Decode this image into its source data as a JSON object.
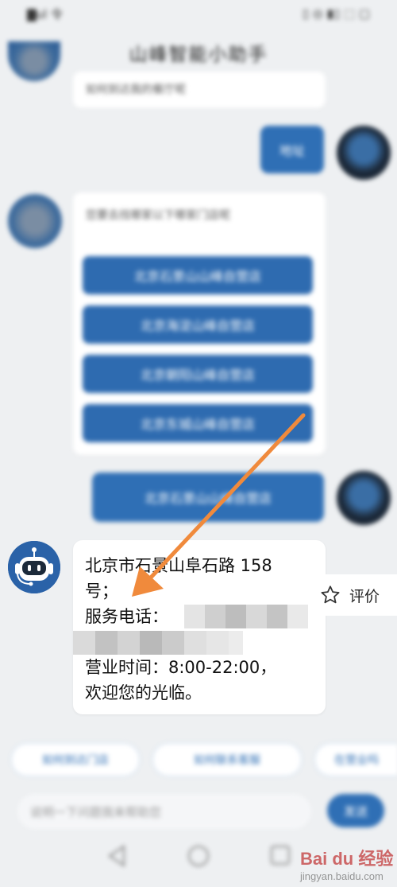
{
  "status_bar": {
    "left": "▇ul 令 ",
    "right": "▯ ◎ ▮▯ ⬚ ▢"
  },
  "header": {
    "back_icon": "chevron-left-icon",
    "title": "山峰智能小助手"
  },
  "messages": {
    "bot_first_tail": "如何到达我的餐厅呢",
    "user_first": "地址",
    "bot_prompt": "您要去找哪家以下哪家门店呢",
    "options": [
      "北京石景山山峰自营店",
      "北京海淀山峰自营店",
      "北京朝阳山峰自营店",
      "北京东城山峰自营店"
    ],
    "user_choice": "北京石景山山峰自营店",
    "answer": {
      "line1": "北京市石景山阜石路 158",
      "line2": "号；",
      "line3": "服务电话：",
      "line5": "营业时间：8:00-22:00，",
      "line6": "欢迎您的光临。"
    }
  },
  "rate": {
    "icon": "star-icon",
    "label": "评价"
  },
  "quick_chips": [
    "如何到达门店",
    "如何联系客服",
    "在营业吗"
  ],
  "input": {
    "placeholder": "说明一下问题我来帮助您",
    "send_label": "发送"
  },
  "watermark": {
    "text": "Bai du 经验",
    "sub": "jingyan.baidu.com"
  },
  "colors": {
    "accent": "#2f6fb5",
    "arrow": "#f08a3c"
  }
}
